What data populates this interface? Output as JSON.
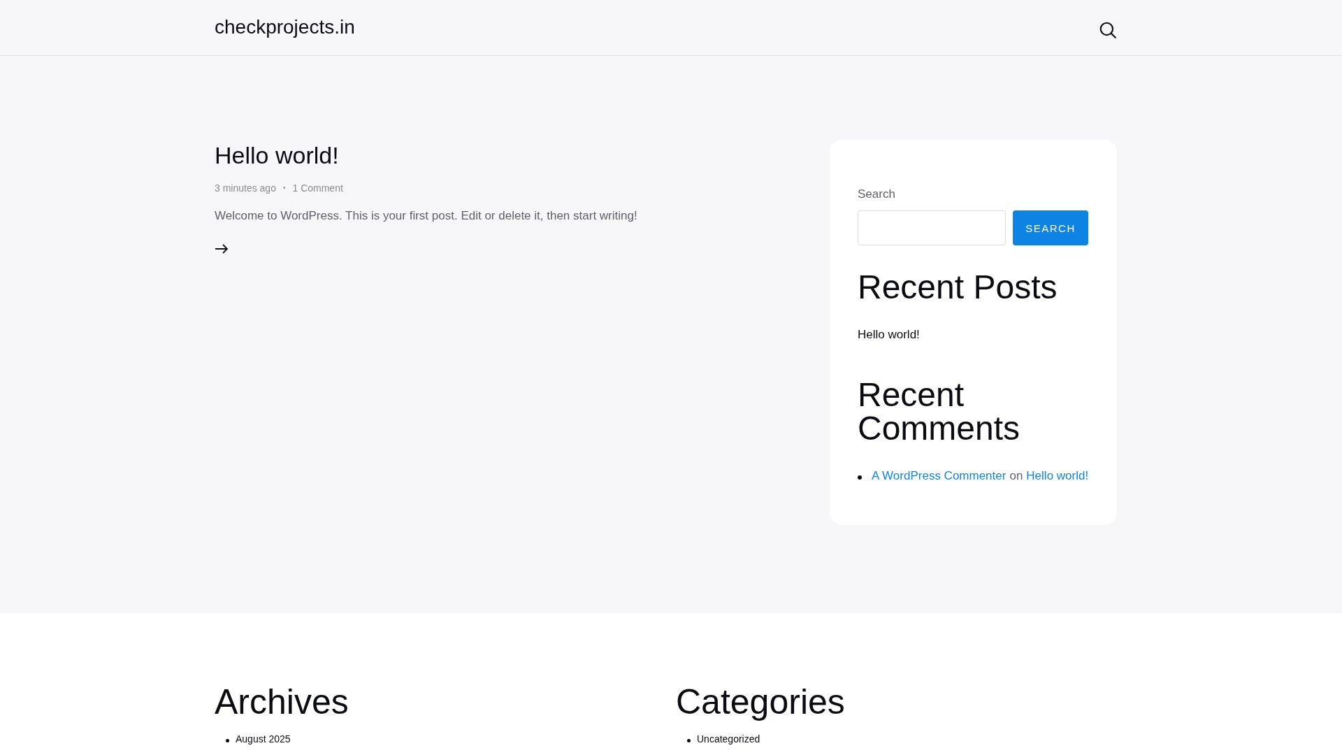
{
  "header": {
    "site_title": "checkprojects.in"
  },
  "post": {
    "title": "Hello world!",
    "date": "3 minutes ago",
    "separator": "•",
    "comments": "1 Comment",
    "excerpt": "Welcome to WordPress. This is your first post. Edit or delete it, then start writing!"
  },
  "sidebar": {
    "search_label": "Search",
    "search_button": "SEARCH",
    "recent_posts_title": "Recent Posts",
    "recent_posts": [
      "Hello world!"
    ],
    "recent_comments_title": "Recent Comments",
    "recent_comments": [
      {
        "author": "A WordPress Commenter",
        "connector": "on",
        "post": "Hello world!"
      }
    ]
  },
  "footer": {
    "widgets": [
      {
        "title": "Archives",
        "items": [
          "August 2025"
        ]
      },
      {
        "title": "Categories",
        "items": [
          "Uncategorized"
        ]
      }
    ]
  }
}
